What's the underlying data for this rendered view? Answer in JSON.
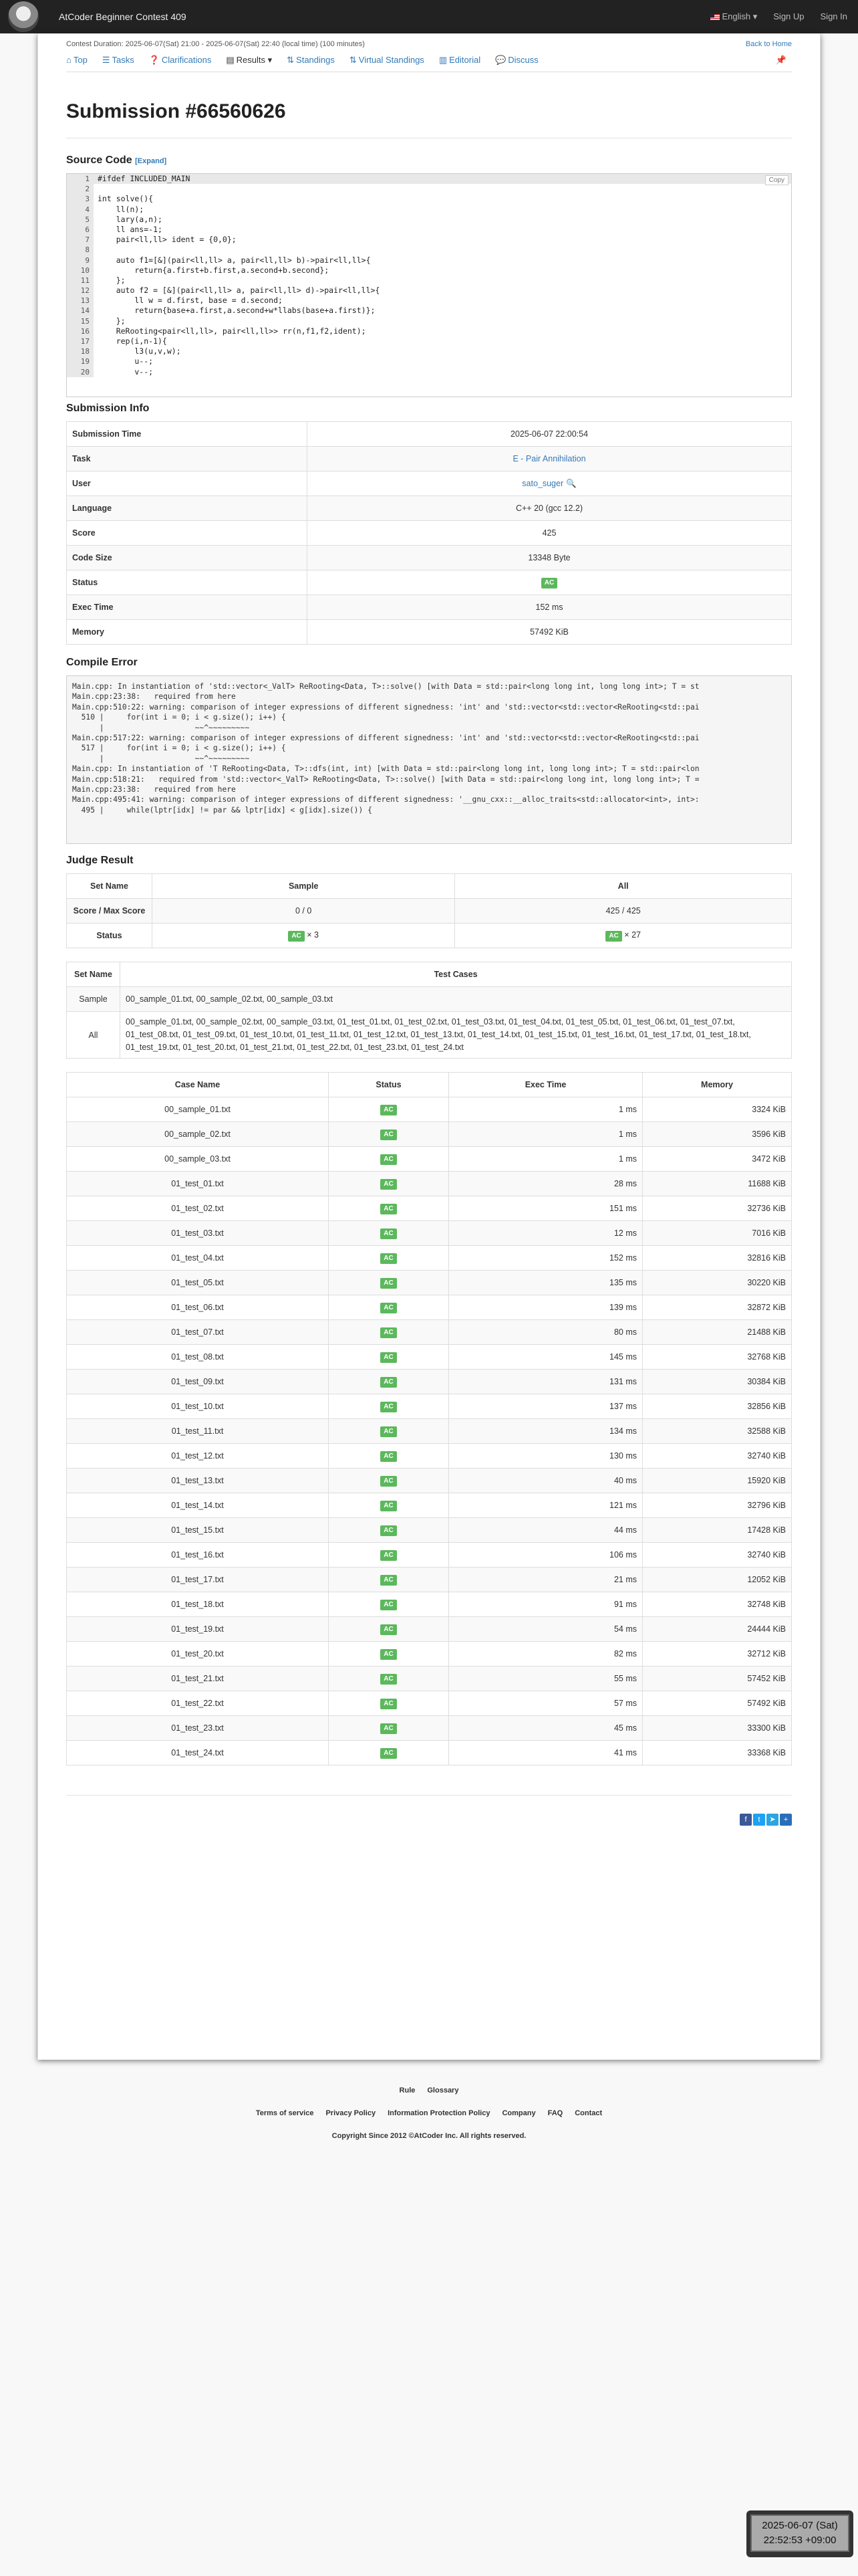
{
  "navbar": {
    "brand": "AtCoder Beginner Contest 409",
    "language": "English",
    "signup": "Sign Up",
    "signin": "Sign In"
  },
  "contest": {
    "duration": "Contest Duration: 2025-06-07(Sat) 21:00 - 2025-06-07(Sat) 22:40 (local time) (100 minutes)",
    "back_home": "Back to Home"
  },
  "tabs": [
    "Top",
    "Tasks",
    "Clarifications",
    "Results",
    "Standings",
    "Virtual Standings",
    "Editorial",
    "Discuss"
  ],
  "title": "Submission #66560626",
  "source": {
    "heading": "Source Code",
    "expand": "[Expand]",
    "copy": "Copy",
    "lines": [
      "#ifdef INCLUDED_MAIN",
      "",
      "int solve(){",
      "    ll(n);",
      "    lary(a,n);",
      "    ll ans=-1;",
      "    pair<ll,ll> ident = {0,0};",
      "",
      "    auto f1=[&](pair<ll,ll> a, pair<ll,ll> b)->pair<ll,ll>{",
      "        return{a.first+b.first,a.second+b.second};",
      "    };",
      "    auto f2 = [&](pair<ll,ll> a, pair<ll,ll> d)->pair<ll,ll>{",
      "        ll w = d.first, base = d.second;",
      "        return{base+a.first,a.second+w*llabs(base+a.first)};",
      "    };",
      "    ReRooting<pair<ll,ll>, pair<ll,ll>> rr(n,f1,f2,ident);",
      "    rep(i,n-1){",
      "        l3(u,v,w);",
      "        u--;",
      "        v--;"
    ]
  },
  "info": {
    "heading": "Submission Info",
    "rows": [
      {
        "label": "Submission Time",
        "value": "2025-06-07 22:00:54"
      },
      {
        "label": "Task",
        "value": "E - Pair Annihilation"
      },
      {
        "label": "User",
        "value": "sato_suger"
      },
      {
        "label": "Language",
        "value": "C++ 20 (gcc 12.2)"
      },
      {
        "label": "Score",
        "value": "425"
      },
      {
        "label": "Code Size",
        "value": "13348 Byte"
      },
      {
        "label": "Status",
        "value": "AC"
      },
      {
        "label": "Exec Time",
        "value": "152 ms"
      },
      {
        "label": "Memory",
        "value": "57492 KiB"
      }
    ]
  },
  "compile": {
    "heading": "Compile Error",
    "lines": [
      "Main.cpp: In instantiation of 'std::vector<_ValT> ReRooting<Data, T>::solve() [with Data = std::pair<long long int, long long int>; T = st",
      "Main.cpp:23:38:   required from here",
      "Main.cpp:510:22: warning: comparison of integer expressions of different signedness: 'int' and 'std::vector<std::vector<ReRooting<std::pai",
      "  510 |     for(int i = 0; i < g.size(); i++) {",
      "      |                    ~~^~~~~~~~~~",
      "Main.cpp:517:22: warning: comparison of integer expressions of different signedness: 'int' and 'std::vector<std::vector<ReRooting<std::pai",
      "  517 |     for(int i = 0; i < g.size(); i++) {",
      "      |                    ~~^~~~~~~~~~",
      "Main.cpp: In instantiation of 'T ReRooting<Data, T>::dfs(int, int) [with Data = std::pair<long long int, long long int>; T = std::pair<lon",
      "Main.cpp:518:21:   required from 'std::vector<_ValT> ReRooting<Data, T>::solve() [with Data = std::pair<long long int, long long int>; T =",
      "Main.cpp:23:38:   required from here",
      "Main.cpp:495:41: warning: comparison of integer expressions of different signedness: '__gnu_cxx::__alloc_traits<std::allocator<int>, int>:",
      "  495 |     while(lptr[idx] != par && lptr[idx] < g[idx].size()) {"
    ]
  },
  "judge": {
    "heading": "Judge Result",
    "headers": [
      "Set Name",
      "Sample",
      "All"
    ],
    "score_label": "Score / Max Score",
    "sample_score": "0 / 0",
    "all_score": "425 / 425",
    "status_label": "Status",
    "sample_count": "× 3",
    "all_count": "× 27"
  },
  "sets": {
    "headers": [
      "Set Name",
      "Test Cases"
    ],
    "rows": [
      {
        "name": "Sample",
        "cases": "00_sample_01.txt, 00_sample_02.txt, 00_sample_03.txt"
      },
      {
        "name": "All",
        "cases": "00_sample_01.txt, 00_sample_02.txt, 00_sample_03.txt, 01_test_01.txt, 01_test_02.txt, 01_test_03.txt, 01_test_04.txt, 01_test_05.txt, 01_test_06.txt, 01_test_07.txt, 01_test_08.txt, 01_test_09.txt, 01_test_10.txt, 01_test_11.txt, 01_test_12.txt, 01_test_13.txt, 01_test_14.txt, 01_test_15.txt, 01_test_16.txt, 01_test_17.txt, 01_test_18.txt, 01_test_19.txt, 01_test_20.txt, 01_test_21.txt, 01_test_22.txt, 01_test_23.txt, 01_test_24.txt"
      }
    ]
  },
  "cases": {
    "headers": [
      "Case Name",
      "Status",
      "Exec Time",
      "Memory"
    ],
    "rows": [
      [
        "00_sample_01.txt",
        "AC",
        "1 ms",
        "3324 KiB"
      ],
      [
        "00_sample_02.txt",
        "AC",
        "1 ms",
        "3596 KiB"
      ],
      [
        "00_sample_03.txt",
        "AC",
        "1 ms",
        "3472 KiB"
      ],
      [
        "01_test_01.txt",
        "AC",
        "28 ms",
        "11688 KiB"
      ],
      [
        "01_test_02.txt",
        "AC",
        "151 ms",
        "32736 KiB"
      ],
      [
        "01_test_03.txt",
        "AC",
        "12 ms",
        "7016 KiB"
      ],
      [
        "01_test_04.txt",
        "AC",
        "152 ms",
        "32816 KiB"
      ],
      [
        "01_test_05.txt",
        "AC",
        "135 ms",
        "30220 KiB"
      ],
      [
        "01_test_06.txt",
        "AC",
        "139 ms",
        "32872 KiB"
      ],
      [
        "01_test_07.txt",
        "AC",
        "80 ms",
        "21488 KiB"
      ],
      [
        "01_test_08.txt",
        "AC",
        "145 ms",
        "32768 KiB"
      ],
      [
        "01_test_09.txt",
        "AC",
        "131 ms",
        "30384 KiB"
      ],
      [
        "01_test_10.txt",
        "AC",
        "137 ms",
        "32856 KiB"
      ],
      [
        "01_test_11.txt",
        "AC",
        "134 ms",
        "32588 KiB"
      ],
      [
        "01_test_12.txt",
        "AC",
        "130 ms",
        "32740 KiB"
      ],
      [
        "01_test_13.txt",
        "AC",
        "40 ms",
        "15920 KiB"
      ],
      [
        "01_test_14.txt",
        "AC",
        "121 ms",
        "32796 KiB"
      ],
      [
        "01_test_15.txt",
        "AC",
        "44 ms",
        "17428 KiB"
      ],
      [
        "01_test_16.txt",
        "AC",
        "106 ms",
        "32740 KiB"
      ],
      [
        "01_test_17.txt",
        "AC",
        "21 ms",
        "12052 KiB"
      ],
      [
        "01_test_18.txt",
        "AC",
        "91 ms",
        "32748 KiB"
      ],
      [
        "01_test_19.txt",
        "AC",
        "54 ms",
        "24444 KiB"
      ],
      [
        "01_test_20.txt",
        "AC",
        "82 ms",
        "32712 KiB"
      ],
      [
        "01_test_21.txt",
        "AC",
        "55 ms",
        "57452 KiB"
      ],
      [
        "01_test_22.txt",
        "AC",
        "57 ms",
        "57492 KiB"
      ],
      [
        "01_test_23.txt",
        "AC",
        "45 ms",
        "33300 KiB"
      ],
      [
        "01_test_24.txt",
        "AC",
        "41 ms",
        "33368 KiB"
      ]
    ]
  },
  "footer": {
    "links1": [
      "Rule",
      "Glossary"
    ],
    "links2": [
      "Terms of service",
      "Privacy Policy",
      "Information Protection Policy",
      "Company",
      "FAQ",
      "Contact"
    ],
    "copyright": "Copyright Since 2012 ©AtCoder Inc. All rights reserved."
  },
  "clock": {
    "date": "2025-06-07 (Sat)",
    "time": "22:52:53 +09:00"
  }
}
